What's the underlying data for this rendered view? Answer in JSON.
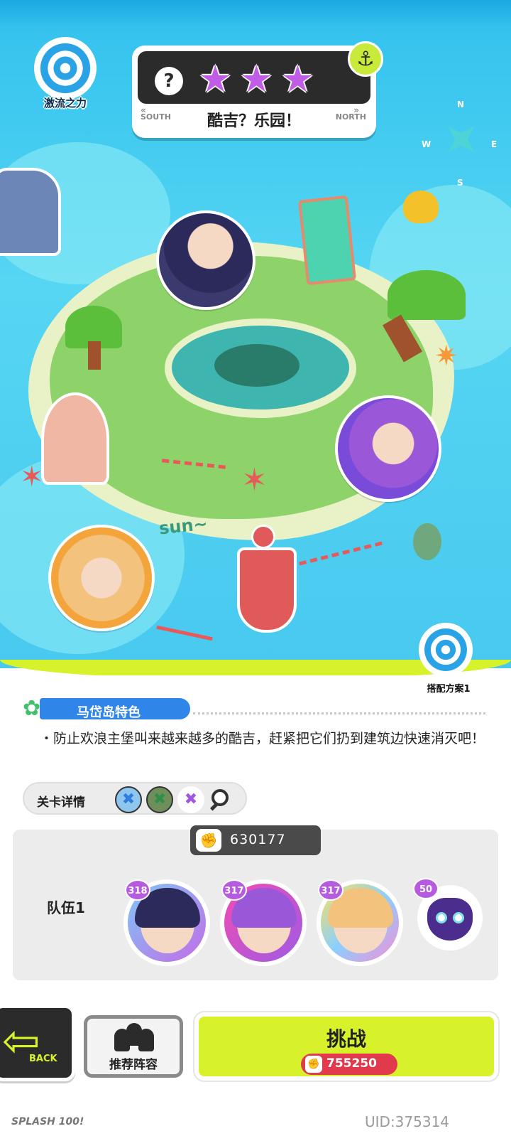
{
  "header": {
    "logo_text": "激流之力",
    "stage_name": "酷吉？乐园！",
    "direction_left": "SOUTH",
    "direction_right": "NORTH",
    "chevron_left": "«",
    "chevron_right": "»",
    "help_symbol": "?",
    "stars_earned": 3,
    "stars_total": 3
  },
  "map": {
    "compass": {
      "n": "N",
      "s": "S",
      "e": "E",
      "w": "W"
    },
    "sun_text": "sun~"
  },
  "outfit_button": {
    "label": "搭配方案1"
  },
  "feature": {
    "title": "马岱岛特色",
    "description": "・防止欢浪主堡叫来越来越多的酷吉，赶紧把它们扔到建筑边快速消灭吧！"
  },
  "stage_details": {
    "label": "关卡详情",
    "chip_colors": [
      "#2f7de0",
      "#2f8f4a",
      "#a057e0"
    ]
  },
  "team": {
    "label": "队伍1",
    "power": "630177",
    "members": [
      {
        "level": "318"
      },
      {
        "level": "317"
      },
      {
        "level": "317"
      }
    ],
    "pet": {
      "level": "50"
    }
  },
  "buttons": {
    "back_label": "BACK",
    "recommend_label": "推荐阵容",
    "challenge_label": "挑战",
    "required_power": "755250"
  },
  "footer": {
    "game_logo": "SPLASH 100!",
    "uid": "UID:375314"
  },
  "colors": {
    "accent_lime": "#d7f12a",
    "accent_blue": "#2f86e8",
    "star_purple": "#c05ce6",
    "power_red": "#e23a4d"
  }
}
